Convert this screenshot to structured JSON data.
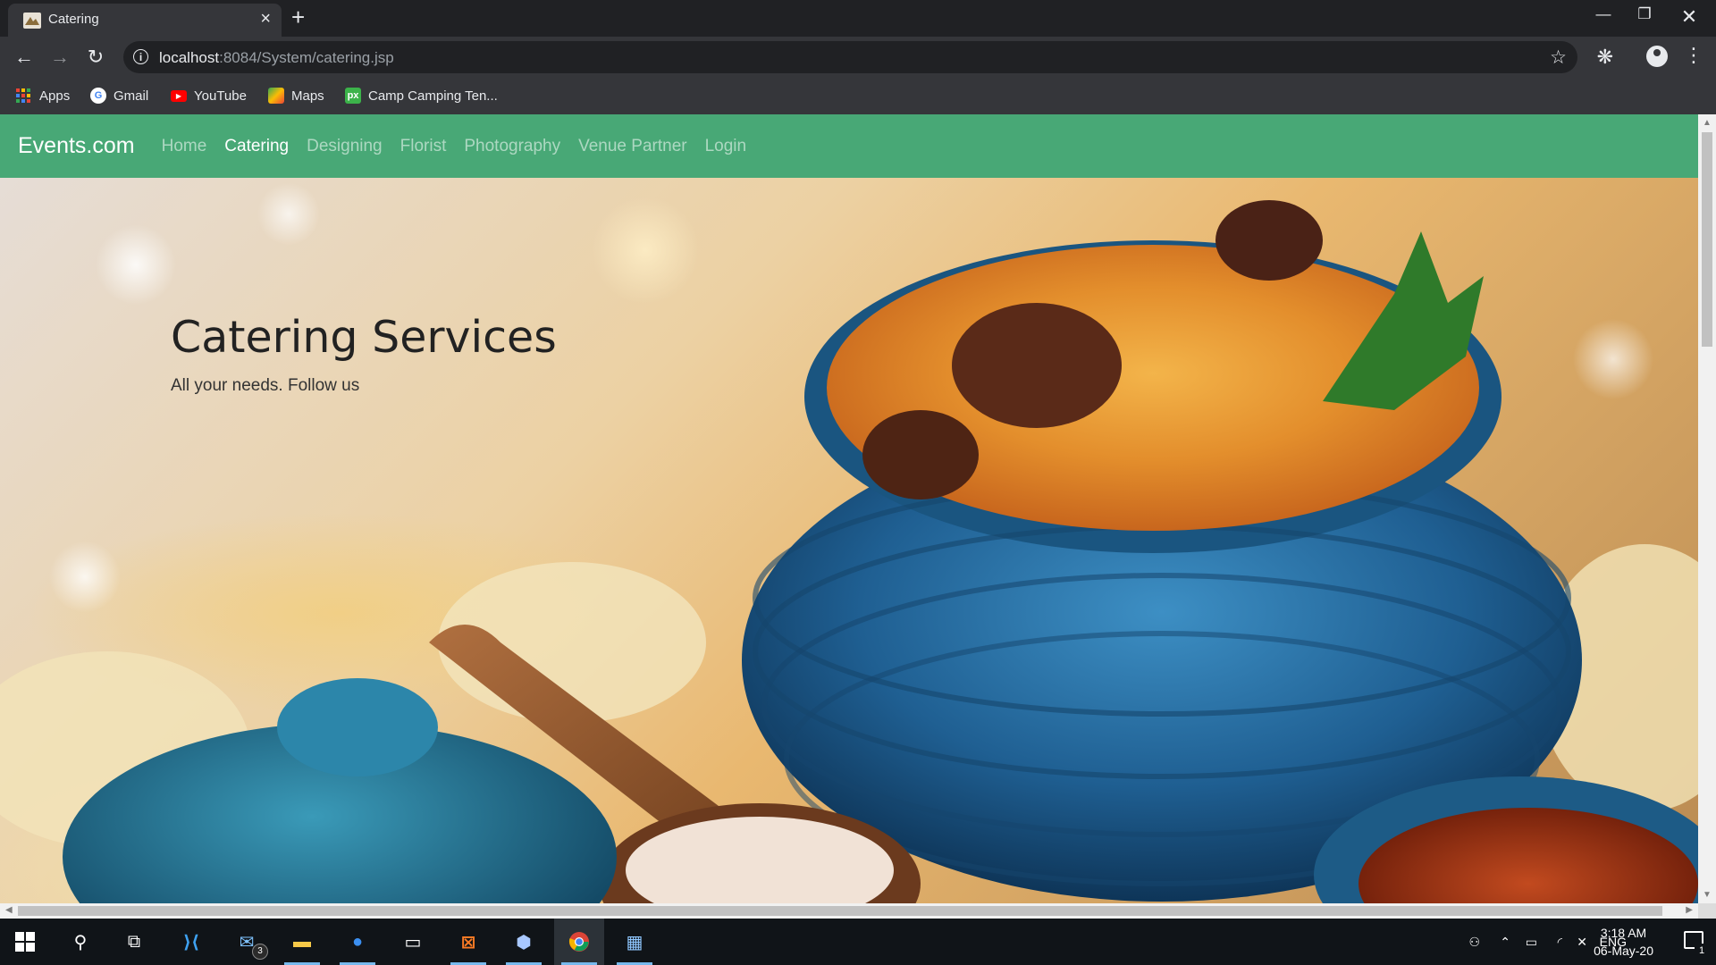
{
  "browser": {
    "tab_title": "Catering",
    "new_tab_symbol": "+",
    "url_host": "localhost",
    "url_path": ":8084/System/catering.jsp",
    "bookmarks": [
      {
        "label": "Apps",
        "icon": "apps-grid-icon"
      },
      {
        "label": "Gmail",
        "icon": "google-icon"
      },
      {
        "label": "YouTube",
        "icon": "youtube-icon"
      },
      {
        "label": "Maps",
        "icon": "maps-icon"
      },
      {
        "label": "Camp Camping Ten...",
        "icon": "px-icon"
      }
    ]
  },
  "navbar": {
    "brand": "Events.com",
    "links": [
      "Home",
      "Catering",
      "Designing",
      "Florist",
      "Photography",
      "Venue Partner",
      "Login"
    ],
    "active_link": "Catering",
    "background_color": "#48a876"
  },
  "hero": {
    "title": "Catering Services",
    "subtitle": "All your needs. Follow us",
    "image_subject": "biryani in blue ceramic pot with wooden spoon"
  },
  "taskbar": {
    "apps": [
      "start",
      "search",
      "task-view",
      "vscode",
      "mail",
      "file-explorer",
      "firefox",
      "terminal",
      "xampp",
      "virtualbox",
      "chrome",
      "photos"
    ],
    "mail_badge": "3",
    "language": "ENG",
    "time": "3:18 AM",
    "date": "06-May-20",
    "notification_count": "1"
  }
}
